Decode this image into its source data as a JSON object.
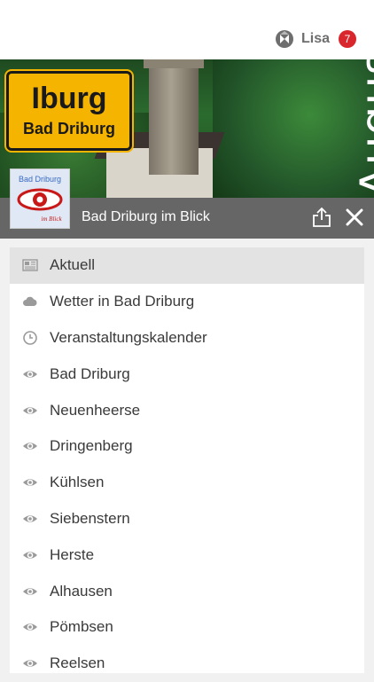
{
  "header": {
    "user_name": "Lisa",
    "notification_count": "7"
  },
  "hero": {
    "sign_city": "Iburg",
    "sign_sub": "Bad Driburg",
    "month_text": "Augus",
    "title": "Bad Driburg im Blick"
  },
  "app_icon": {
    "line1": "Bad Driburg",
    "line2": "im Blick"
  },
  "menu": {
    "items": [
      {
        "label": "Aktuell",
        "icon": "newspaper-icon",
        "active": true
      },
      {
        "label": "Wetter in Bad Driburg",
        "icon": "cloud-icon"
      },
      {
        "label": "Veranstaltungskalender",
        "icon": "clock-icon"
      },
      {
        "label": "Bad Driburg",
        "icon": "eye-icon"
      },
      {
        "label": "Neuenheerse",
        "icon": "eye-icon"
      },
      {
        "label": "Dringenberg",
        "icon": "eye-icon"
      },
      {
        "label": "Kühlsen",
        "icon": "eye-icon"
      },
      {
        "label": "Siebenstern",
        "icon": "eye-icon"
      },
      {
        "label": "Herste",
        "icon": "eye-icon"
      },
      {
        "label": "Alhausen",
        "icon": "eye-icon"
      },
      {
        "label": "Pömbsen",
        "icon": "eye-icon"
      },
      {
        "label": "Reelsen",
        "icon": "eye-icon"
      }
    ]
  },
  "colors": {
    "badge": "#d9262c",
    "sign": "#f5b400",
    "titlebar": "#5a5a5a"
  }
}
